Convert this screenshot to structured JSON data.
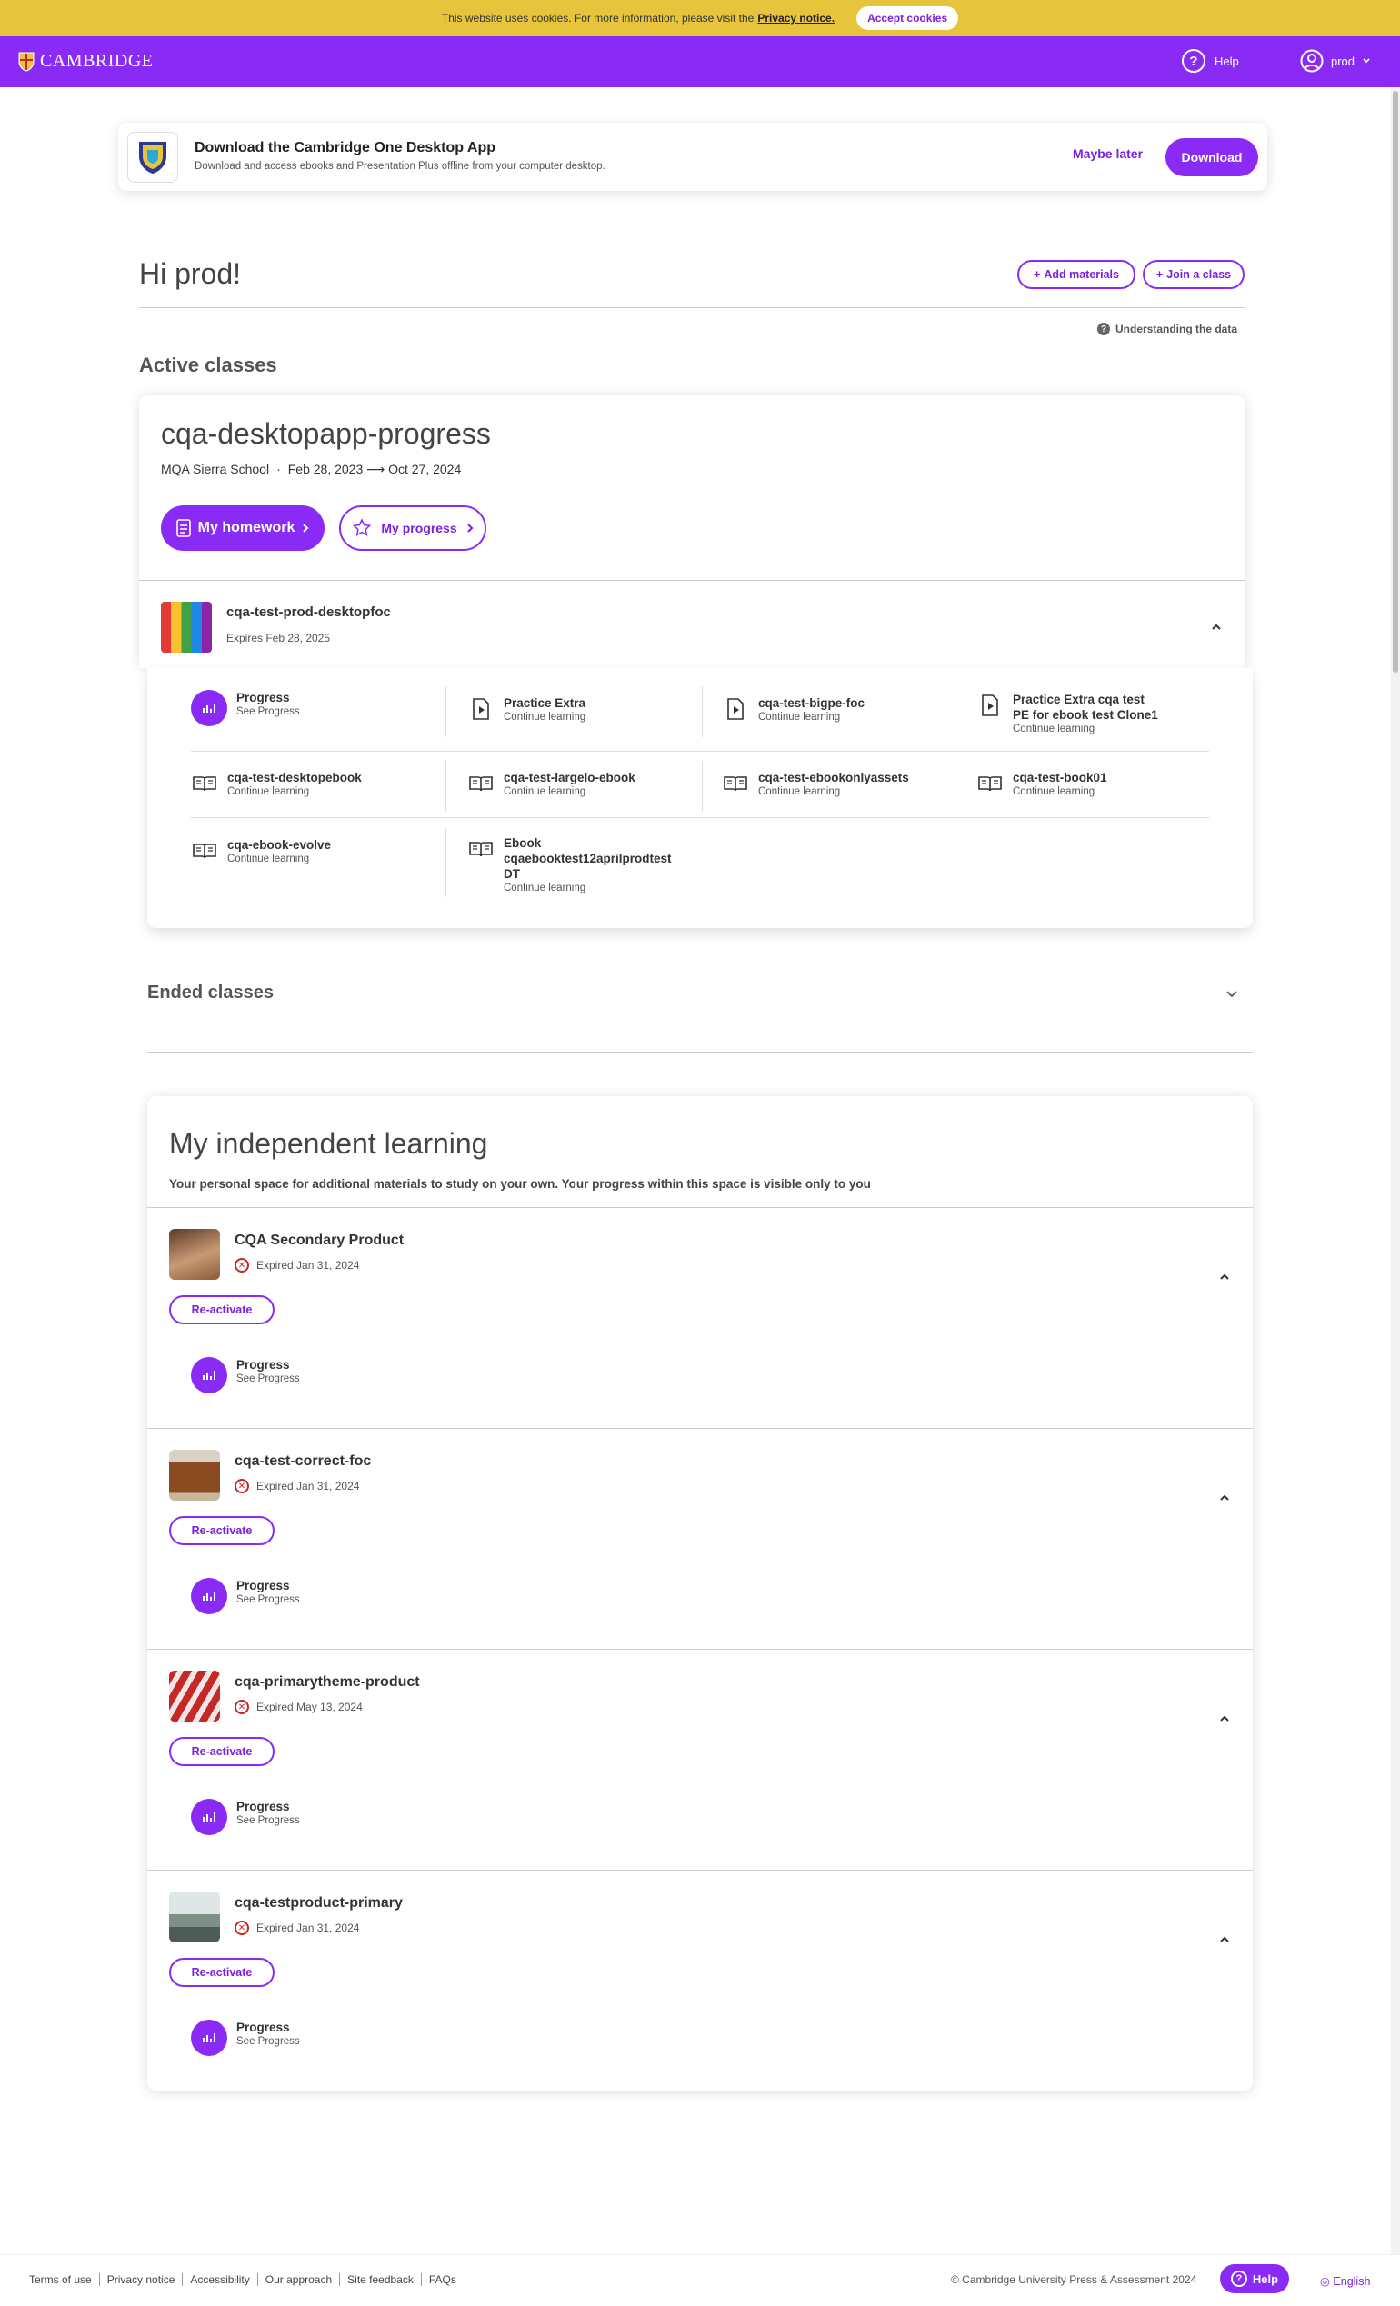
{
  "cookie": {
    "text": "This website uses cookies. For more information, please visit the",
    "link": "Privacy notice.",
    "accept": "Accept cookies"
  },
  "header": {
    "brand": "CAMBRIDGE",
    "help": "Help",
    "user": "prod"
  },
  "download_banner": {
    "title": "Download the Cambridge One Desktop App",
    "subtitle": "Download and access ebooks and Presentation Plus offline from your computer desktop.",
    "maybe_later": "Maybe later",
    "download": "Download"
  },
  "greeting": "Hi prod!",
  "actions": {
    "add_materials": "Add materials",
    "join_class": "Join a class"
  },
  "understanding": "Understanding the data",
  "active_classes_heading": "Active classes",
  "class": {
    "name": "cqa-desktopapp-progress",
    "school": "MQA Sierra School",
    "dates": "Feb 28, 2023 ⟶ Oct 27, 2024",
    "homework": "My homework",
    "progress": "My progress",
    "product": {
      "title": "cqa-test-prod-desktopfoc",
      "expires": "Expires Feb 28, 2025"
    },
    "resources": [
      {
        "title": "Progress",
        "sub": "See Progress",
        "icon": "progress-icon"
      },
      {
        "title": "Practice Extra",
        "sub": "Continue learning",
        "icon": "practice-icon"
      },
      {
        "title": "cqa-test-bigpe-foc",
        "sub": "Continue learning",
        "icon": "practice-icon"
      },
      {
        "title": "Practice Extra cqa test PE for ebook test Clone1",
        "sub": "Continue learning",
        "icon": "practice-icon"
      },
      {
        "title": "cqa-test-desktopebook",
        "sub": "Continue learning",
        "icon": "ebook-icon"
      },
      {
        "title": "cqa-test-largelo-ebook",
        "sub": "Continue learning",
        "icon": "ebook-icon"
      },
      {
        "title": "cqa-test-ebookonlyassets",
        "sub": "Continue learning",
        "icon": "ebook-icon"
      },
      {
        "title": "cqa-test-book01",
        "sub": "Continue learning",
        "icon": "ebook-icon"
      },
      {
        "title": "cqa-ebook-evolve",
        "sub": "Continue learning",
        "icon": "ebook-icon"
      },
      {
        "title": "Ebook cqaebooktest12aprilprodtest DT",
        "sub": "Continue learning",
        "icon": "ebook-icon"
      }
    ]
  },
  "ended_classes_heading": "Ended classes",
  "independent": {
    "title": "My independent learning",
    "subtitle": "Your personal space for additional materials to study on your own. Your progress within this space is visible only to you",
    "reactivate": "Re-activate",
    "progress_title": "Progress",
    "progress_sub": "See Progress",
    "products": [
      {
        "title": "CQA Secondary Product",
        "expired": "Expired Jan 31, 2024"
      },
      {
        "title": "cqa-test-correct-foc",
        "expired": "Expired Jan 31, 2024"
      },
      {
        "title": "cqa-primarytheme-product",
        "expired": "Expired May 13, 2024"
      },
      {
        "title": "cqa-testproduct-primary",
        "expired": "Expired Jan 31, 2024"
      }
    ]
  },
  "footer": {
    "links": [
      "Terms of use",
      "Privacy notice",
      "Accessibility",
      "Our approach",
      "Site feedback",
      "FAQs"
    ],
    "copyright": "© Cambridge University Press & Assessment 2024",
    "help": "Help",
    "language": "English"
  },
  "colors": {
    "brand": "#8a2bf5",
    "cookie_bar": "#e6c43c",
    "expired": "#c62828"
  }
}
